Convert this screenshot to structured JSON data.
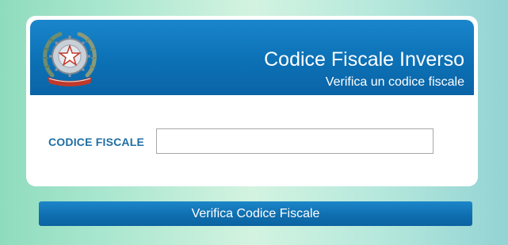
{
  "header": {
    "title": "Codice Fiscale Inverso",
    "subtitle": "Verifica un codice fiscale",
    "emblem_icon": "italian-republic-emblem-icon",
    "emblem_text": "REPUBBLICA ITALIANA"
  },
  "form": {
    "label": "CODICE FISCALE",
    "input_value": "",
    "input_placeholder": ""
  },
  "actions": {
    "submit_label": "Verifica Codice Fiscale"
  },
  "colors": {
    "header_blue": "#0d72b7",
    "label_blue": "#1f6ea3",
    "button_blue": "#0f6fb0"
  }
}
